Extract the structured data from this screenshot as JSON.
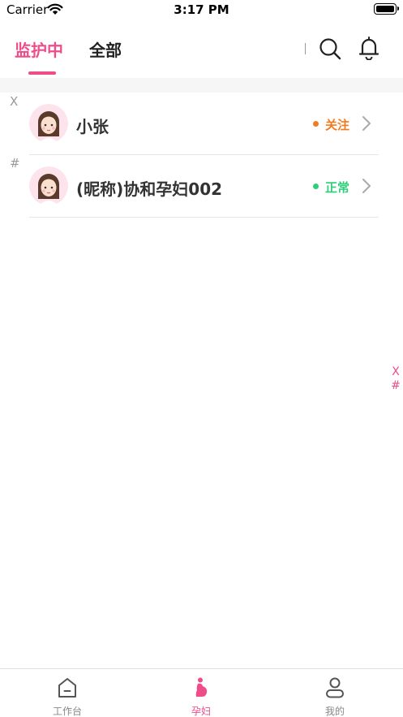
{
  "status_bar": {
    "carrier": "Carrier",
    "time": "3:17 PM"
  },
  "header": {
    "tabs": [
      {
        "label": "监护中",
        "active": true
      },
      {
        "label": "全部",
        "active": false
      }
    ],
    "icons": [
      "search-icon",
      "bell-icon"
    ]
  },
  "sections": [
    {
      "letter": "X",
      "items": [
        {
          "name": "小张",
          "status": "关注",
          "status_color": "#f47a20",
          "avatar": "girl-avatar"
        }
      ]
    },
    {
      "letter": "#",
      "items": [
        {
          "name": "(昵称)协和孕妇002",
          "status": "正常",
          "status_color": "#2fcf7a",
          "avatar": "girl-avatar"
        }
      ]
    }
  ],
  "index_bar": [
    "X",
    "#"
  ],
  "tabbar": {
    "items": [
      {
        "label": "工作台",
        "icon": "home-icon",
        "active": false
      },
      {
        "label": "孕妇",
        "icon": "pregnant-woman-icon",
        "active": true
      },
      {
        "label": "我的",
        "icon": "user-icon",
        "active": false
      }
    ]
  },
  "colors": {
    "accent": "#ee4d8a",
    "watch": "#f47a20",
    "normal": "#2fcf7a"
  }
}
